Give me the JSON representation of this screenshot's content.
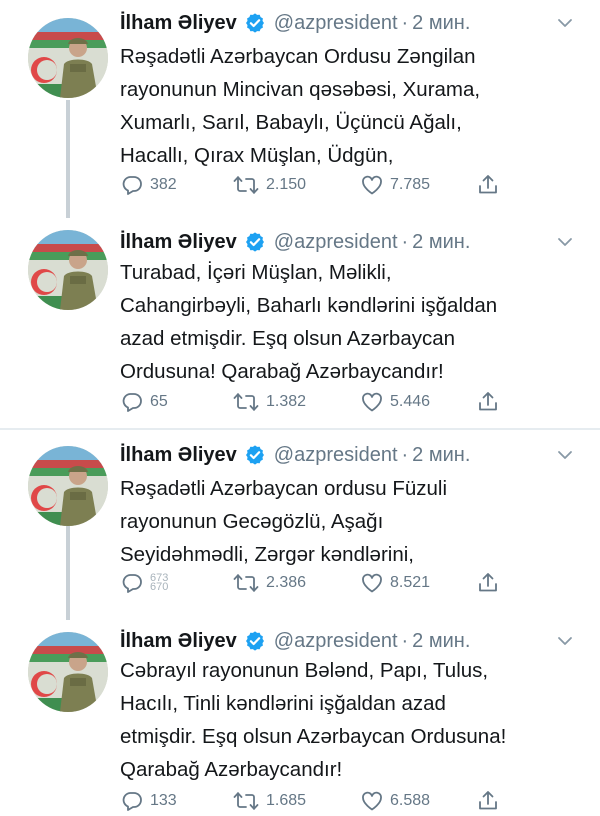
{
  "tweets": [
    {
      "name": "İlham Əliyev",
      "handle": "@azpresident",
      "dot": "·",
      "time": "2 мин.",
      "text": "Rəşadətli Azərbaycan Ordusu Zəngilan\nrayonunun Mincivan qəsəbəsi, Xurama,\nXumarlı, Sarıl, Babaylı, Üçüncü Ağalı,\nHacallı, Qırax Müşlan, Üdgün,",
      "replies": "382",
      "retweets": "2.150",
      "likes": "7.785"
    },
    {
      "name": "İlham Əliyev",
      "handle": "@azpresident",
      "dot": "·",
      "time": "2 мин.",
      "text": "Turabad, İçəri Müşlan, Məlikli,\nCahangirbəyli, Baharlı kəndlərini işğaldan\nazad etmişdir. Eşq olsun Azərbaycan\nOrdusuna! Qarabağ Azərbaycandır!",
      "replies": "65",
      "retweets": "1.382",
      "likes": "5.446"
    },
    {
      "name": "İlham Əliyev",
      "handle": "@azpresident",
      "dot": "·",
      "time": "2 мин.",
      "text": "Rəşadətli Azərbaycan ordusu Füzuli\nrayonunun Gecəgözlü, Aşağı\nSeyidəhmədli, Zərgər kəndlərini,",
      "replies_top": "673",
      "replies_bottom": "670",
      "retweets": "2.386",
      "likes": "8.521"
    },
    {
      "name": "İlham Əliyev",
      "handle": "@azpresident",
      "dot": "·",
      "time": "2 мин.",
      "text": "Cəbrayıl rayonunun Bələnd, Papı, Tulus,\nHacılı, Tinli kəndlərini işğaldan azad\netmişdir. Eşq olsun Azərbaycan Ordusuna!\nQarabağ Azərbaycandır!",
      "replies": "133",
      "retweets": "1.685",
      "likes": "6.588"
    }
  ],
  "icons": {
    "verified": "verified-badge-icon",
    "caret": "chevron-down-icon",
    "reply": "reply-bubble-icon",
    "retweet": "retweet-icon",
    "like": "heart-icon",
    "share": "share-icon"
  },
  "colors": {
    "verified_blue": "#1da1f2",
    "muted_text": "#657786",
    "divider": "#e6ecf0",
    "thread_line": "#c8d0d6"
  }
}
